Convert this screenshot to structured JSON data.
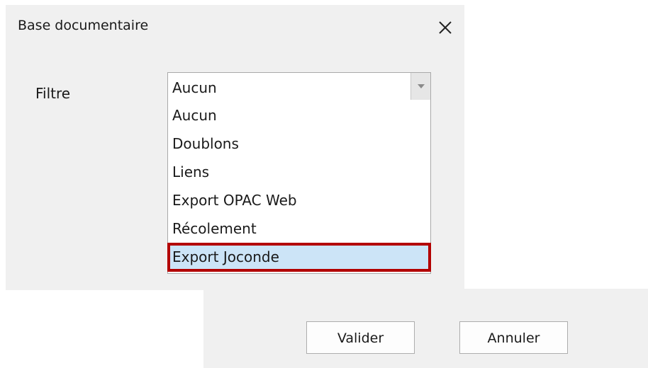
{
  "dialog": {
    "title": "Base documentaire",
    "close_icon": "close-icon"
  },
  "filter": {
    "label": "Filtre",
    "selected_value": "Aucun",
    "dropdown_icon": "chevron-down-icon",
    "options": [
      "Aucun",
      "Doublons",
      "Liens",
      "Export OPAC Web",
      "Récolement",
      "Export Joconde"
    ],
    "highlighted_option": "Export Joconde"
  },
  "buttons": {
    "validate_label": "Valider",
    "cancel_label": "Annuler"
  },
  "colors": {
    "panel_background": "#f0f0f0",
    "highlight_background": "#cce4f7",
    "highlight_border": "#b30000"
  }
}
